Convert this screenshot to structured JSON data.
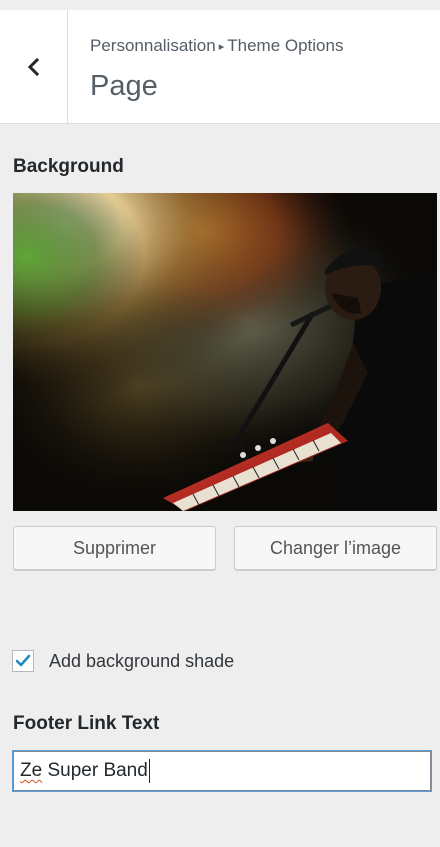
{
  "header": {
    "breadcrumb_parent": "Personnalisation",
    "breadcrumb_separator": "▸",
    "breadcrumb_current": "Theme Options",
    "title": "Page",
    "back_icon": "chevron-left-icon"
  },
  "background_section": {
    "title": "Background",
    "image_description": "Musician singing into a microphone while playing a red keyboard on a smoky stage with colorful lights",
    "remove_label": "Supprimer",
    "change_label": "Changer l’image"
  },
  "shade_option": {
    "checked": true,
    "label": "Add background shade"
  },
  "footer_link": {
    "title": "Footer Link Text",
    "value_misspelled_word": "Ze",
    "value_rest": " Super Band"
  },
  "colors": {
    "accent": "#0073aa",
    "panel_bg": "#eeeeee",
    "focus_ring": "#5b9dd9"
  }
}
